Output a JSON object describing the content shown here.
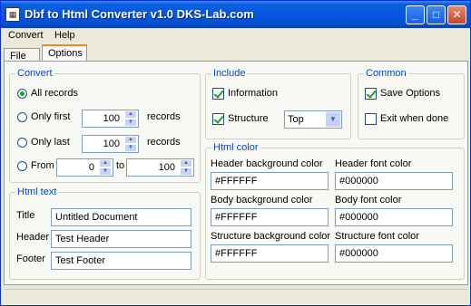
{
  "window": {
    "title": "Dbf to Html Converter v1.0   DKS-Lab.com",
    "min": "_",
    "max": "□",
    "close": "✕"
  },
  "menu": {
    "convert": "Convert",
    "help": "Help"
  },
  "tabs": {
    "file": "File",
    "options": "Options",
    "active": "Options"
  },
  "convert": {
    "legend": "Convert",
    "all": "All records",
    "first": "Only first",
    "first_value": "100",
    "first_suffix": "records",
    "last": "Only last",
    "last_value": "100",
    "last_suffix": "records",
    "from": "From",
    "from_value": "0",
    "to": "to",
    "to_value": "100",
    "selected": "all"
  },
  "include": {
    "legend": "Include",
    "information": "Information",
    "information_checked": true,
    "structure": "Structure",
    "structure_checked": true,
    "position": "Top"
  },
  "common": {
    "legend": "Common",
    "save_options": "Save Options",
    "save_checked": true,
    "exit_done": "Exit when done",
    "exit_checked": false
  },
  "html_text": {
    "legend": "Html text",
    "title_label": "Title",
    "title_value": "Untitled Document",
    "header_label": "Header",
    "header_value": "Test Header",
    "footer_label": "Footer",
    "footer_value": "Test Footer"
  },
  "html_color": {
    "legend": "Html color",
    "header_bg_label": "Header background color",
    "header_bg": "#FFFFFF",
    "header_font_label": "Header font color",
    "header_font": "#000000",
    "body_bg_label": "Body background color",
    "body_bg": "#FFFFFF",
    "body_font_label": "Body font color",
    "body_font": "#000000",
    "struct_bg_label": "Structure background color",
    "struct_bg": "#FFFFFF",
    "struct_font_label": "Structure font color",
    "struct_font": "#000000"
  }
}
